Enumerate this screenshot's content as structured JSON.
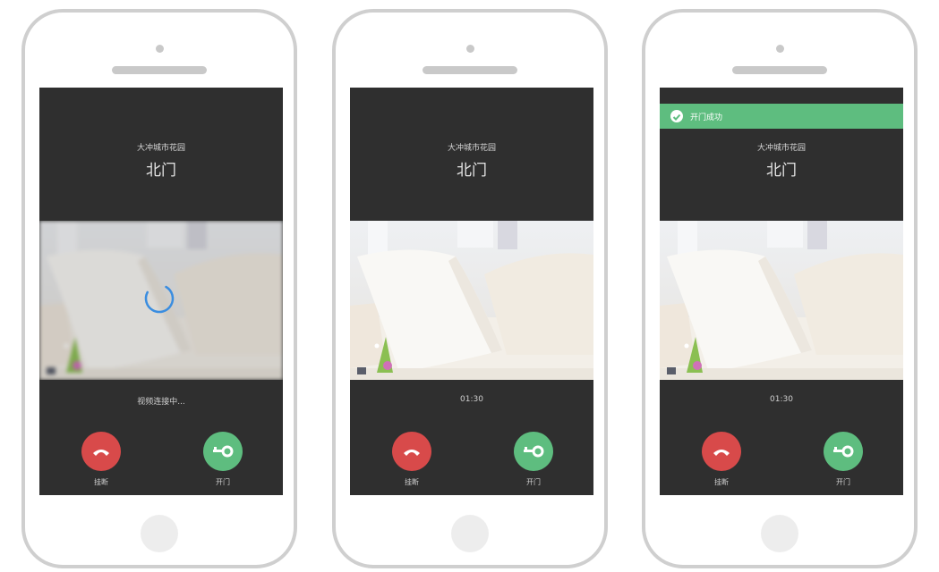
{
  "colors": {
    "screen_bg": "#2f2f2f",
    "hangup": "#d84a4a",
    "open_door": "#5ebd7f",
    "toast": "#5ebd7f",
    "spinner": "#3a8de0",
    "phone_frame": "#cfcfcf"
  },
  "screens": [
    {
      "community": "大冲城市花园",
      "gate": "北门",
      "status": "视频连接中...",
      "hangup_label": "挂断",
      "open_label": "开门",
      "hangup_icon": "phone-hangup-icon",
      "open_icon": "key-icon",
      "video": "sofa-with-pillows-image",
      "loading": true
    },
    {
      "community": "大冲城市花园",
      "gate": "北门",
      "status": "01:30",
      "hangup_label": "挂断",
      "open_label": "开门",
      "hangup_icon": "phone-hangup-icon",
      "open_icon": "key-icon",
      "video": "sofa-with-pillows-image"
    },
    {
      "community": "大冲城市花园",
      "gate": "北门",
      "status": "01:30",
      "hangup_label": "挂断",
      "open_label": "开门",
      "hangup_icon": "phone-hangup-icon",
      "open_icon": "key-icon",
      "video": "sofa-with-pillows-image",
      "toast": {
        "text": "开门成功",
        "icon": "check-circle-icon"
      }
    }
  ]
}
